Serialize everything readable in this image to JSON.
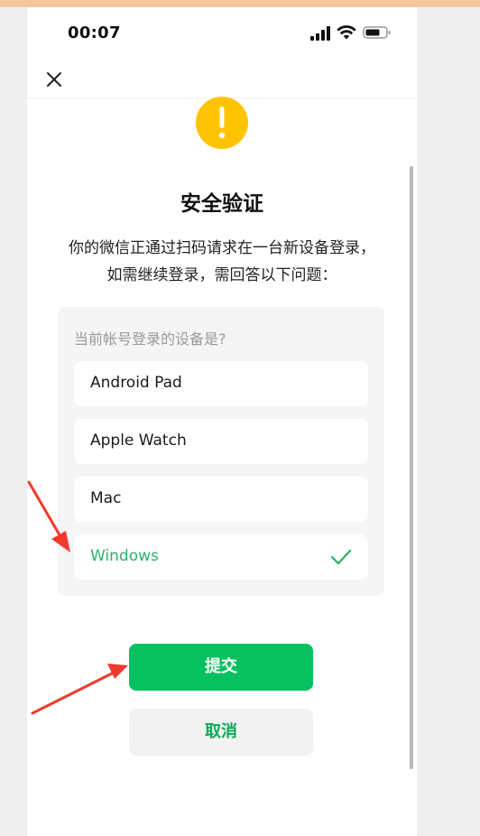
{
  "status_bar": {
    "time": "00:07",
    "icons": [
      "signal-icon",
      "wifi-icon",
      "battery-icon"
    ]
  },
  "nav": {
    "close_icon": "close-icon"
  },
  "dialog": {
    "icon": "warning-icon",
    "title": "安全验证",
    "description": "你的微信正通过扫码请求在一台新设备登录，如需继续登录，需回答以下问题："
  },
  "question": {
    "prompt": "当前帐号登录的设备是?",
    "options": [
      {
        "label": "Android Pad",
        "selected": false
      },
      {
        "label": "Apple Watch",
        "selected": false
      },
      {
        "label": "Mac",
        "selected": false
      },
      {
        "label": "Windows",
        "selected": true
      }
    ]
  },
  "actions": {
    "submit_label": "提交",
    "cancel_label": "取消"
  },
  "colors": {
    "accent_green": "#07c160",
    "selected_text": "#2bb16a",
    "warning_yellow": "#ffc300",
    "annotation_red": "#f03a2e"
  }
}
